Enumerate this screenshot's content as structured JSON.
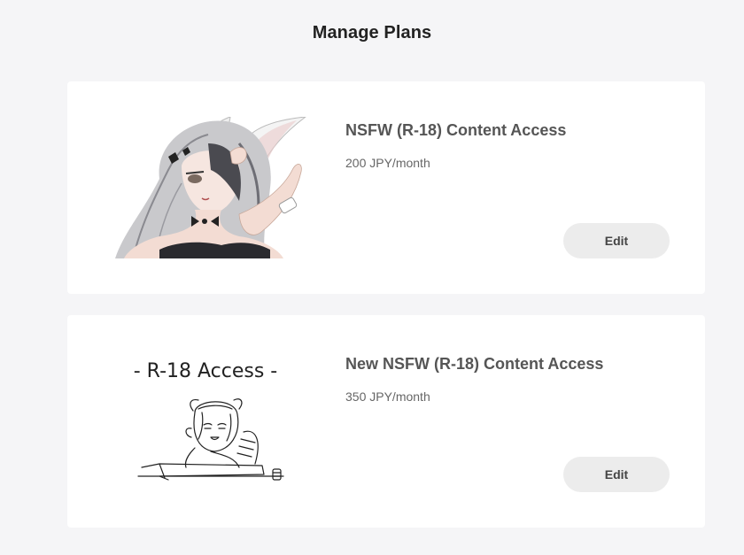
{
  "page": {
    "title": "Manage Plans"
  },
  "plans": [
    {
      "name": "NSFW (R-18) Content Access",
      "price": "200 JPY/month",
      "edit_label": "Edit",
      "image": "anime-bunny-girl-illustration"
    },
    {
      "name": "New NSFW (R-18) Content Access",
      "price": "350 JPY/month",
      "edit_label": "Edit",
      "image": "line-sketch-character-at-desk",
      "image_caption": "- R-18 Access -"
    }
  ]
}
